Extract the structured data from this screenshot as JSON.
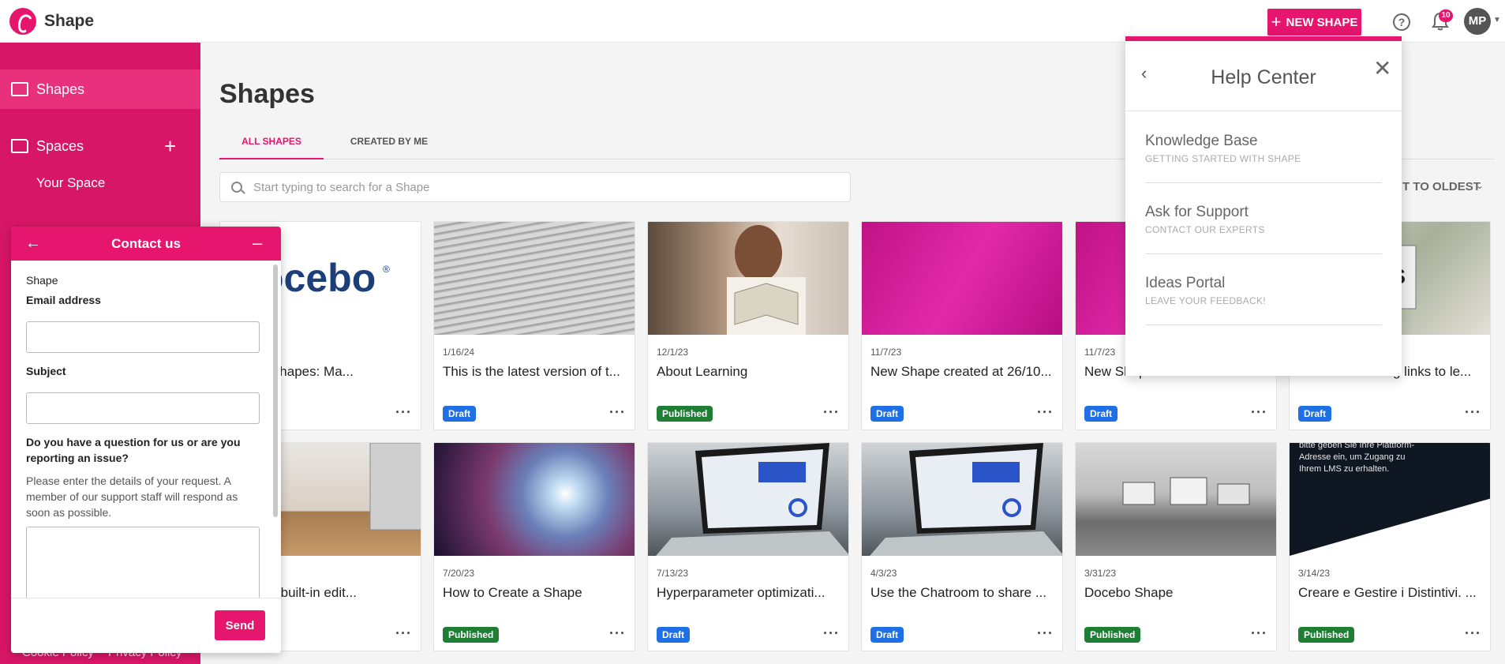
{
  "brand": {
    "name": "Shape",
    "logo_icon": "shape-logo-icon",
    "accent": "#e6156e"
  },
  "header": {
    "new_shape_label": "NEW SHAPE",
    "help_icon": "help-circle-icon",
    "notification_count": "10",
    "avatar_initials": "MP"
  },
  "sidebar": {
    "items": [
      {
        "label": "Shapes",
        "icon": "shapes-icon"
      },
      {
        "label": "Spaces",
        "icon": "folder-icon"
      }
    ],
    "sub_items": [
      "Your Space"
    ],
    "footer_links": [
      "Cookie Policy",
      "Privacy Policy"
    ]
  },
  "main": {
    "title": "Shapes",
    "tabs": [
      "ALL SHAPES",
      "CREATED BY ME"
    ],
    "search_placeholder": "Start typing to search for a Shape",
    "sort_label": "T TO OLDEST"
  },
  "cards": [
    {
      "date": "",
      "title": "g Your Shapes: Ma...",
      "badge": "",
      "image": "docebo-logo"
    },
    {
      "date": "1/16/24",
      "title": "This is the latest version of t...",
      "badge": "Draft",
      "image": "text-paper"
    },
    {
      "date": "12/1/23",
      "title": "About Learning",
      "badge": "Published",
      "image": "woman-reading-book"
    },
    {
      "date": "11/7/23",
      "title": "New Shape created at 26/10...",
      "badge": "Draft",
      "image": "magenta-gradient"
    },
    {
      "date": "11/7/23",
      "title": "New Shape created at 26/10...",
      "badge": "Draft",
      "image": "magenta-gradient"
    },
    {
      "date": "",
      "title": "Use the following links to le...",
      "badge": "Draft",
      "image": "money-letters"
    },
    {
      "date": "",
      "title": "Shape's built-in edit...",
      "badge": "",
      "image": "computer-desk"
    },
    {
      "date": "7/20/23",
      "title": "How to Create a Shape",
      "badge": "Published",
      "image": "space-nebula"
    },
    {
      "date": "7/13/23",
      "title": "Hyperparameter optimizati...",
      "badge": "Draft",
      "image": "laptop-dashboard"
    },
    {
      "date": "4/3/23",
      "title": "Use the Chatroom to share ...",
      "badge": "Draft",
      "image": "laptop-dashboard"
    },
    {
      "date": "3/31/23",
      "title": "Docebo Shape",
      "badge": "Published",
      "image": "village-grayscale"
    },
    {
      "date": "3/14/23",
      "title": "Creare e Gestire i Distintivi. ...",
      "badge": "Published",
      "image": "dark-text-slide"
    }
  ],
  "card_overlay_text": "bitte geben Sie Ihre Plattform-Adresse ein, um Zugang zu Ihrem LMS zu erhalten.",
  "help_center": {
    "title": "Help Center",
    "items": [
      {
        "title": "Knowledge Base",
        "subtitle": "GETTING STARTED WITH SHAPE"
      },
      {
        "title": "Ask for Support",
        "subtitle": "CONTACT OUR EXPERTS"
      },
      {
        "title": "Ideas Portal",
        "subtitle": "LEAVE YOUR FEEDBACK!"
      }
    ]
  },
  "contact": {
    "title": "Contact us",
    "org": "Shape",
    "email_label": "Email address",
    "subject_label": "Subject",
    "question_label": "Do you have a question for us or are you reporting an issue?",
    "question_desc": "Please enter the details of your request. A member of our support staff will respond as soon as possible.",
    "send_label": "Send"
  }
}
